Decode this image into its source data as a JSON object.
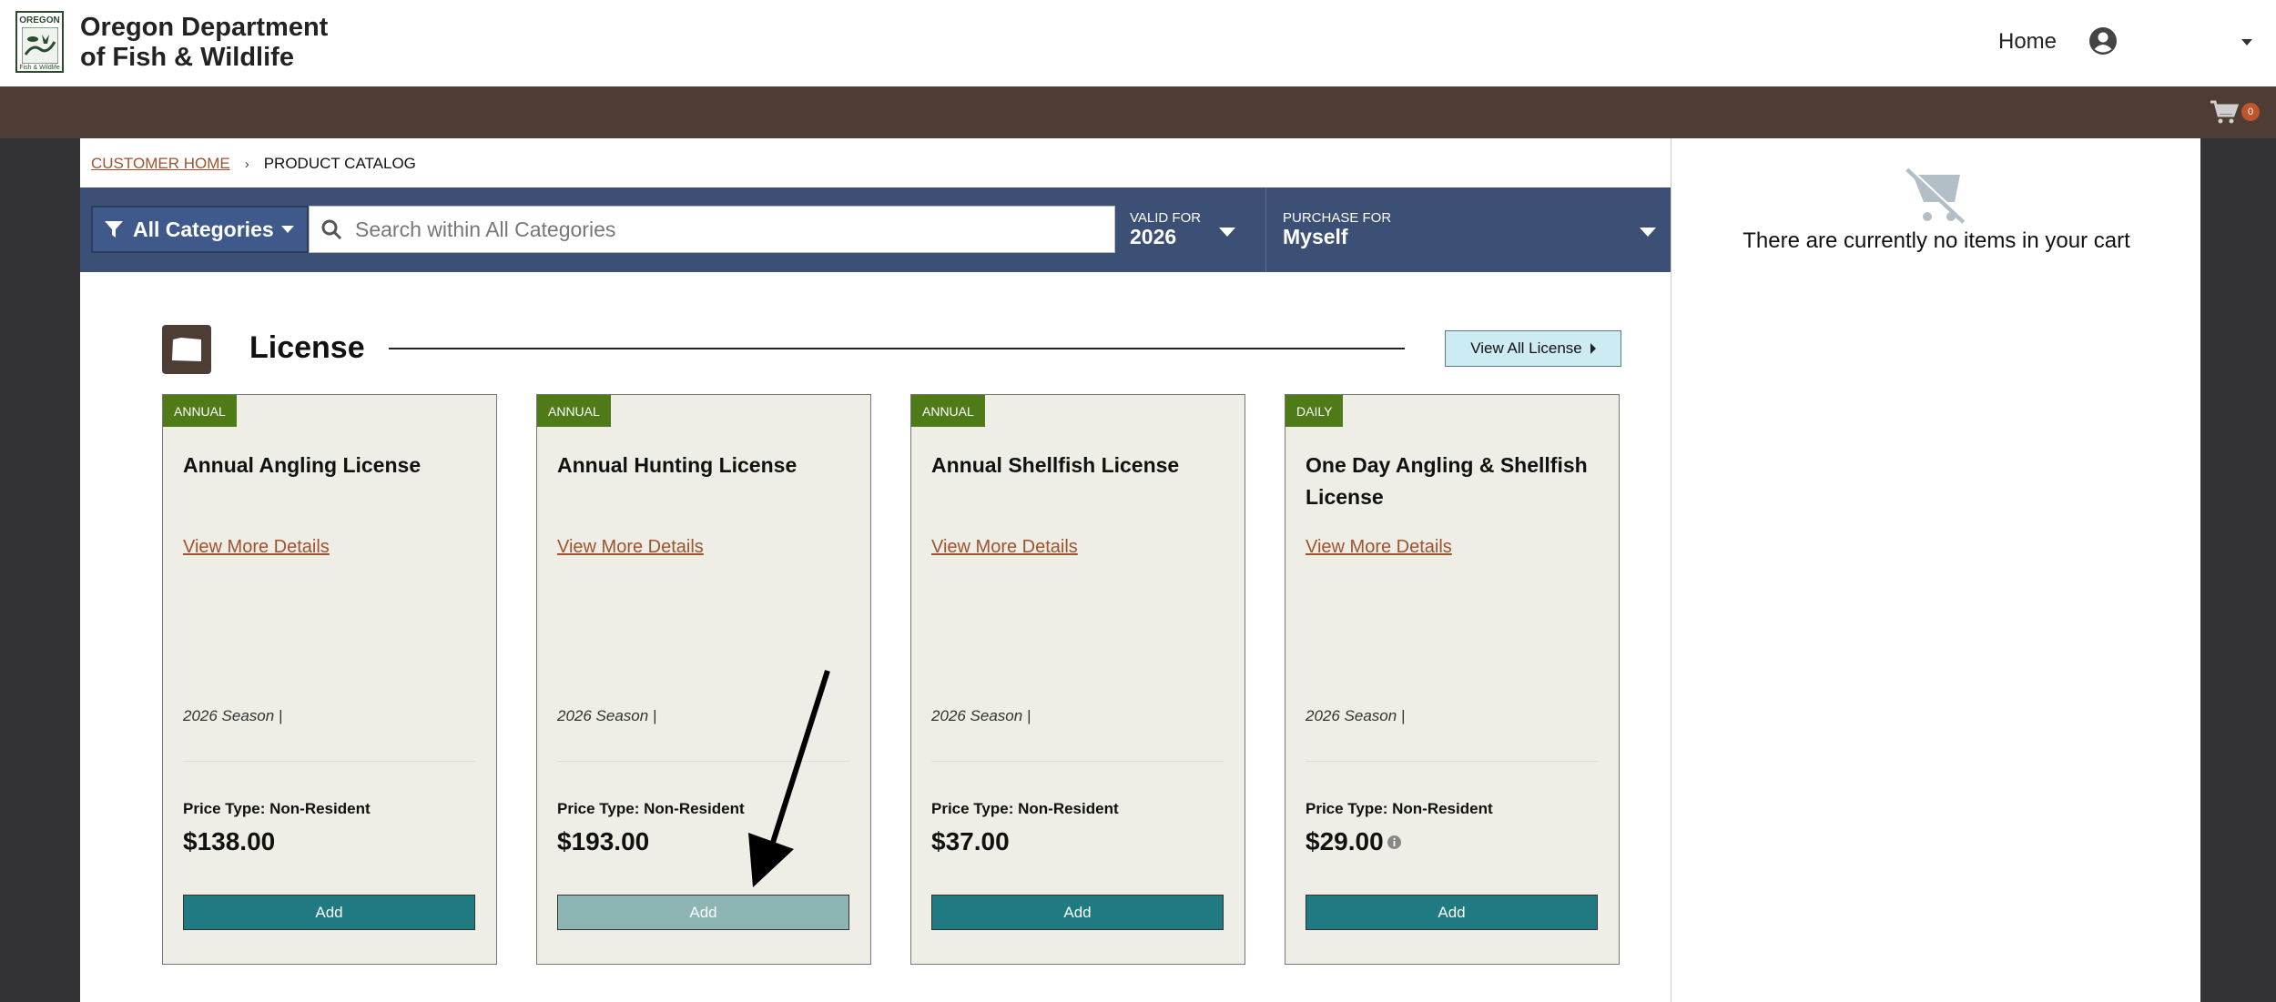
{
  "header": {
    "logo": {
      "top": "OREGON",
      "bottom": "Fish & Wildlife"
    },
    "org_line1": "Oregon Department",
    "org_line2": "of Fish & Wildlife",
    "nav_home": "Home"
  },
  "cart": {
    "count": "0",
    "empty_message": "There are currently no items in your cart"
  },
  "breadcrumb": {
    "home": "Customer Home",
    "current": "Product Catalog",
    "separator": "›"
  },
  "filters": {
    "category": "All Categories",
    "search_placeholder": "Search within All Categories",
    "valid_for": {
      "label": "Valid For",
      "value": "2026"
    },
    "purchase_for": {
      "label": "Purchase For",
      "value": "Myself"
    }
  },
  "section": {
    "title": "License",
    "view_all": "View All License"
  },
  "products": [
    {
      "badge": "ANNUAL",
      "title": "Annual Angling License",
      "link": "View More Details",
      "season": "2026 Season  |",
      "price_type": "Price Type: Non-Resident",
      "price": "$138.00",
      "add": "Add"
    },
    {
      "badge": "ANNUAL",
      "title": "Annual Hunting License",
      "link": "View More Details",
      "season": "2026 Season  |",
      "price_type": "Price Type: Non-Resident",
      "price": "$193.00",
      "add": "Add"
    },
    {
      "badge": "ANNUAL",
      "title": "Annual Shellfish License",
      "link": "View More Details",
      "season": "2026 Season  |",
      "price_type": "Price Type: Non-Resident",
      "price": "$37.00",
      "add": "Add"
    },
    {
      "badge": "DAILY",
      "title": "One Day Angling & Shellfish License",
      "link": "View More Details",
      "season": "2026 Season  |",
      "price_type": "Price Type: Non-Resident",
      "price": "$29.00",
      "add": "Add"
    }
  ],
  "colors": {
    "accent": "#1f7a82",
    "brand_brown": "#4d3d35",
    "filter_bar": "#3c4f74",
    "badge_green": "#4e7a18",
    "link": "#a0522d"
  }
}
